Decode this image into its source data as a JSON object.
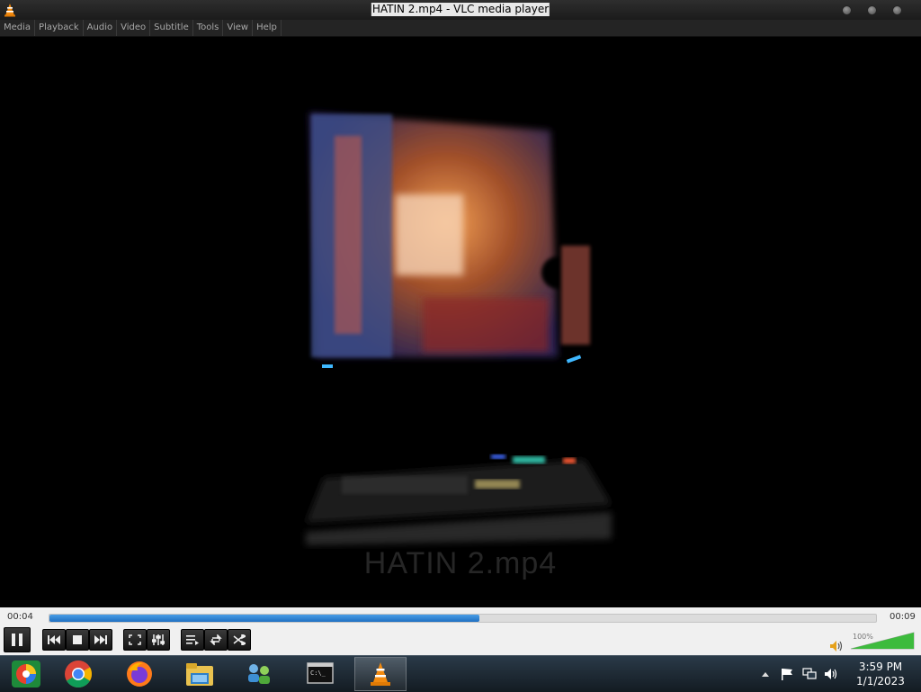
{
  "window": {
    "title": "HATIN 2.mp4 - VLC media player",
    "app_icon": "vlc-cone-icon"
  },
  "menu": [
    "Media",
    "Playback",
    "Audio",
    "Video",
    "Subtitle",
    "Tools",
    "View",
    "Help"
  ],
  "video": {
    "overlay_title": "HATIN 2.mp4"
  },
  "playback": {
    "elapsed": "00:04",
    "total": "00:09",
    "progress": 0.52,
    "state": "playing"
  },
  "volume": {
    "label": "100%",
    "level": 1.0
  },
  "taskbar": {
    "apps": [
      "color-wheel-icon",
      "chrome-icon",
      "firefox-icon",
      "file-explorer-icon",
      "network-people-icon",
      "command-prompt-icon",
      "vlc-cone-icon"
    ],
    "active_app": "vlc-cone-icon",
    "tray_icons": [
      "show-hidden-icons-arrow",
      "action-center-flag-icon",
      "network-icon",
      "speaker-icon"
    ],
    "time": "3:59 PM",
    "date": "1/1/2023"
  },
  "colors": {
    "seek_fill": "#2a7fd4",
    "volume_fill": "#3dbb3d",
    "vlc_orange": "#f28a0f"
  }
}
